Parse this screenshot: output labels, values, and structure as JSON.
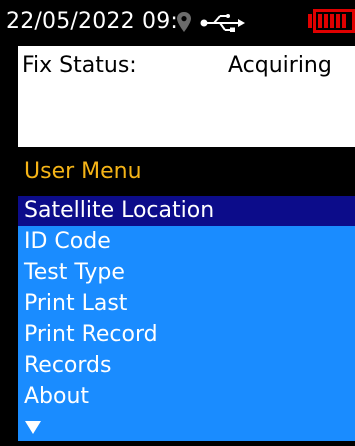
{
  "status_bar": {
    "datetime": "22/05/2022 09:",
    "icons": [
      "location-pin-icon",
      "usb-icon",
      "battery-icon"
    ]
  },
  "fix": {
    "label": "Fix Status:",
    "value": "Acquiring"
  },
  "menu": {
    "title": "User Menu",
    "items": [
      {
        "label": "Satellite Location",
        "selected": true
      },
      {
        "label": "ID Code",
        "selected": false
      },
      {
        "label": "Test Type",
        "selected": false
      },
      {
        "label": "Print Last",
        "selected": false
      },
      {
        "label": "Print Record",
        "selected": false
      },
      {
        "label": "Records",
        "selected": false
      },
      {
        "label": "About",
        "selected": false
      }
    ],
    "more_icon": "down-arrow-icon"
  },
  "colors": {
    "background": "#000000",
    "title": "#f5b417",
    "list_background": "#1a8cff",
    "selected_background": "#0c0c8a",
    "battery": "#e00000"
  }
}
